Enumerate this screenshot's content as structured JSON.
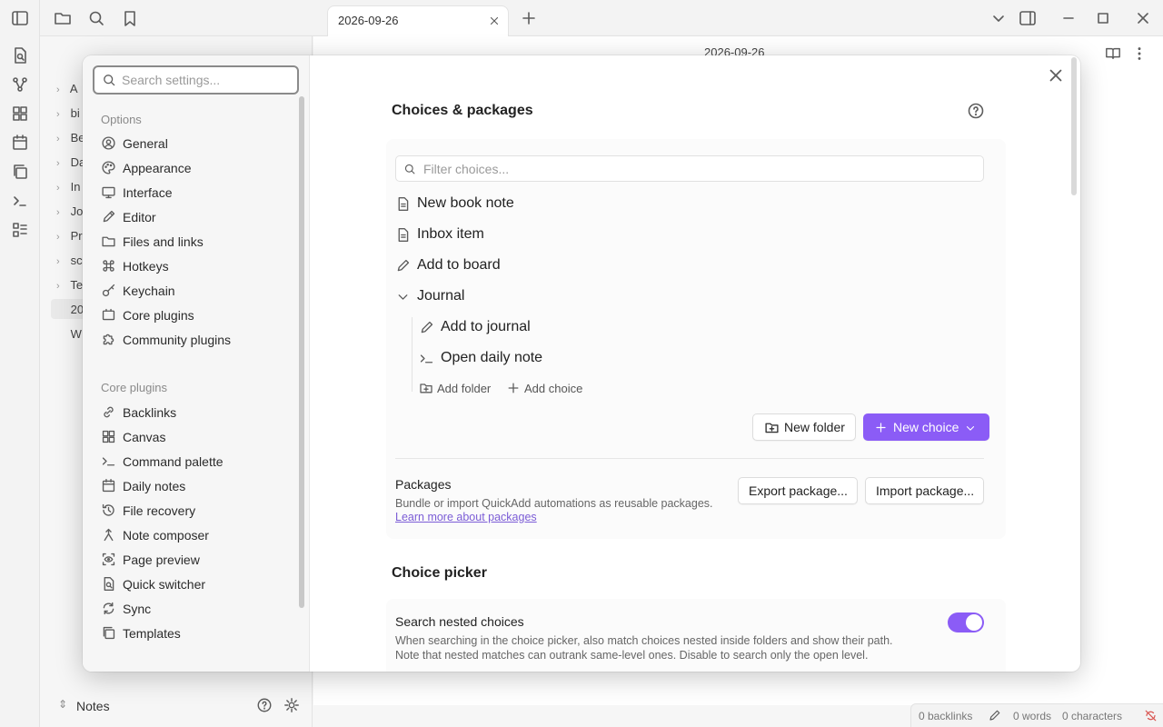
{
  "window": {
    "tab_title": "2026-09-26",
    "editor_title": "2026-09-26"
  },
  "sidebar": {
    "tree_items": [
      "A",
      "bi",
      "Be",
      "Da",
      "In",
      "Jo",
      "Pr",
      "sc",
      "Te",
      "20",
      "W"
    ],
    "vault_name": "Notes"
  },
  "status_bar": {
    "backlinks": "0 backlinks",
    "words": "0 words",
    "characters": "0 characters"
  },
  "settings_nav": {
    "search_placeholder": "Search settings...",
    "options_heading": "Options",
    "options": [
      {
        "label": "General",
        "icon": "user-circle-icon"
      },
      {
        "label": "Appearance",
        "icon": "palette-icon"
      },
      {
        "label": "Interface",
        "icon": "monitor-icon"
      },
      {
        "label": "Editor",
        "icon": "pencil-icon"
      },
      {
        "label": "Files and links",
        "icon": "folder-icon"
      },
      {
        "label": "Hotkeys",
        "icon": "command-icon"
      },
      {
        "label": "Keychain",
        "icon": "key-icon"
      },
      {
        "label": "Core plugins",
        "icon": "plug-icon"
      },
      {
        "label": "Community plugins",
        "icon": "puzzle-icon"
      }
    ],
    "core_heading": "Core plugins",
    "core_plugins": [
      {
        "label": "Backlinks",
        "icon": "link-icon"
      },
      {
        "label": "Canvas",
        "icon": "grid-icon"
      },
      {
        "label": "Command palette",
        "icon": "terminal-icon"
      },
      {
        "label": "Daily notes",
        "icon": "calendar-icon"
      },
      {
        "label": "File recovery",
        "icon": "history-icon"
      },
      {
        "label": "Note composer",
        "icon": "merge-icon"
      },
      {
        "label": "Page preview",
        "icon": "eye-scan-icon"
      },
      {
        "label": "Quick switcher",
        "icon": "file-search-icon"
      },
      {
        "label": "Sync",
        "icon": "sync-icon"
      },
      {
        "label": "Templates",
        "icon": "copy-icon"
      }
    ]
  },
  "content": {
    "section_title": "Choices & packages",
    "filter_placeholder": "Filter choices...",
    "choices": [
      {
        "label": "New book note",
        "icon": "file-text-icon"
      },
      {
        "label": "Inbox item",
        "icon": "file-text-icon"
      },
      {
        "label": "Add to board",
        "icon": "pencil-icon"
      },
      {
        "label": "Journal",
        "icon": "chevron-down-icon"
      }
    ],
    "nested_choices": [
      {
        "label": "Add to journal",
        "icon": "pencil-icon"
      },
      {
        "label": "Open daily note",
        "icon": "terminal-icon"
      }
    ],
    "add_folder_label": "Add folder",
    "add_choice_label": "Add choice",
    "new_folder_label": "New folder",
    "new_choice_label": "New choice",
    "packages": {
      "name": "Packages",
      "description": "Bundle or import QuickAdd automations as reusable packages.",
      "link": "Learn more about packages",
      "export_label": "Export package...",
      "import_label": "Import package..."
    },
    "picker_title": "Choice picker",
    "search_nested": {
      "name": "Search nested choices",
      "description_line1": "When searching in the choice picker, also match choices nested inside folders and show their path.",
      "description_line2": "Note that nested matches can outrank same-level ones. Disable to search only the open level.",
      "enabled": true
    },
    "accent_color": "#8b5cf6"
  }
}
